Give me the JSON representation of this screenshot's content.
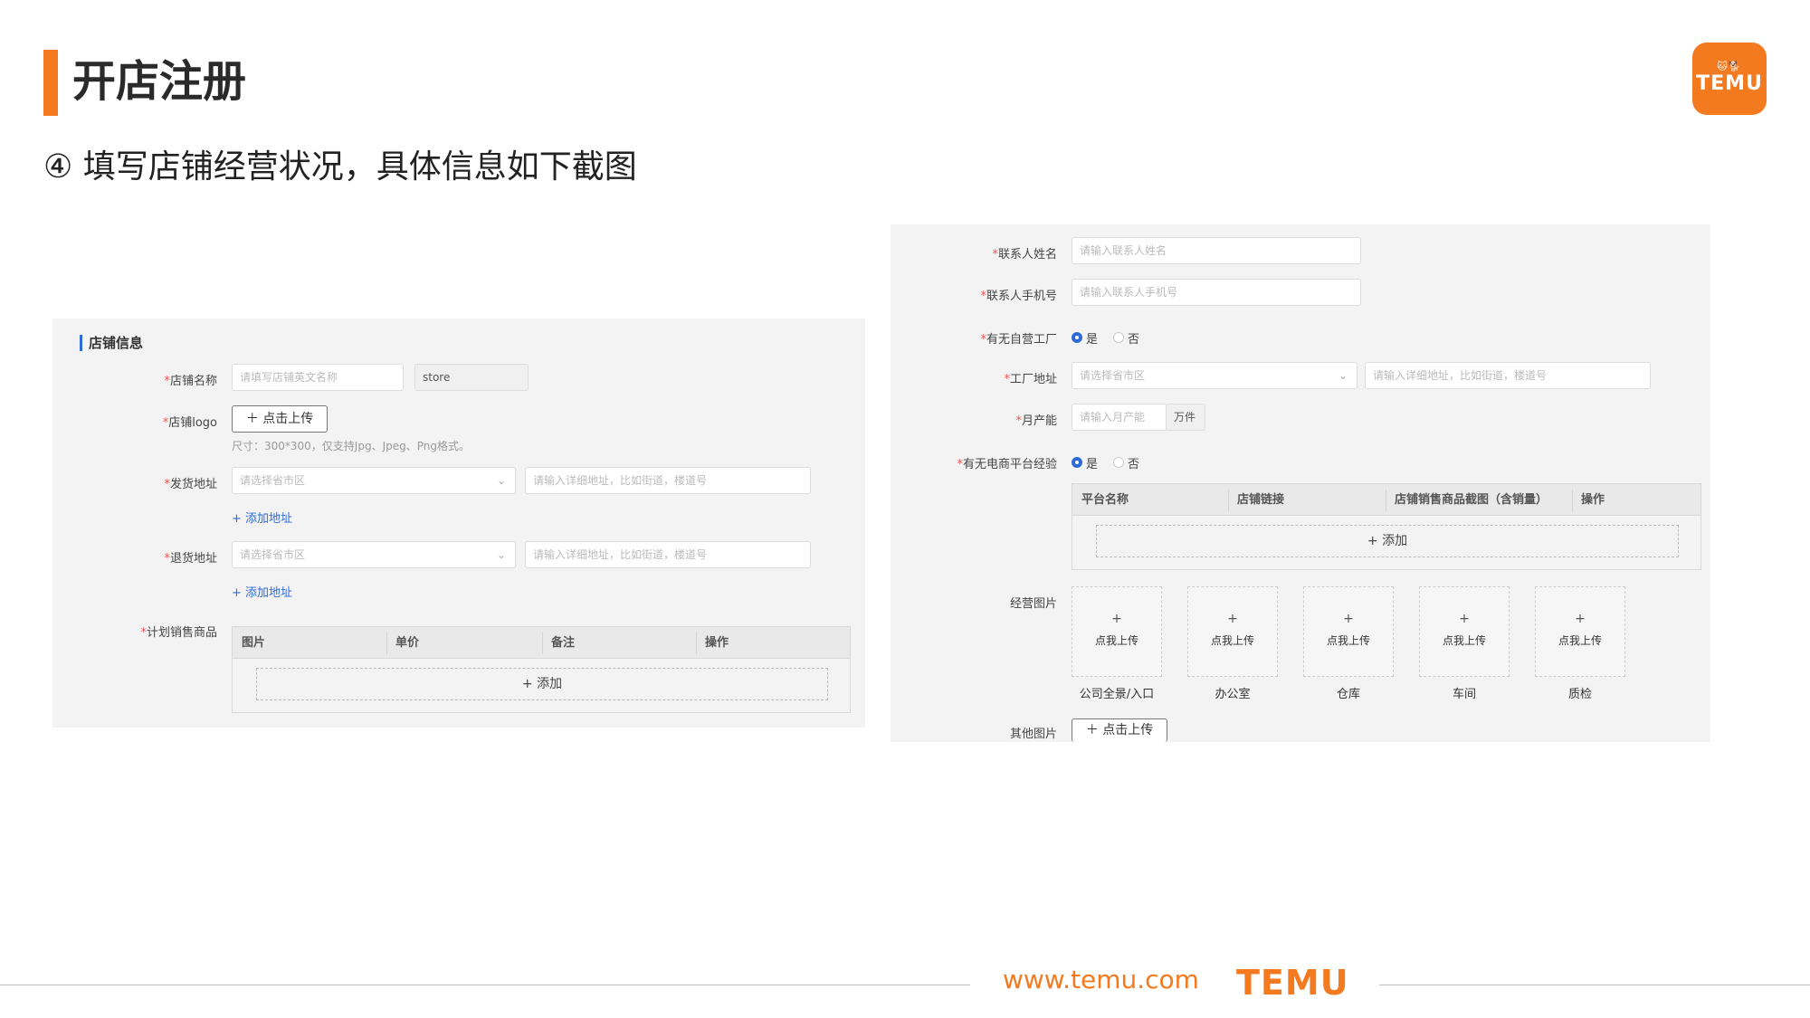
{
  "slide": {
    "title": "开店注册",
    "subtitle": "④ 填写店铺经营状况，具体信息如下截图",
    "logo": {
      "small": "🐱🐕",
      "word": "TEMU"
    },
    "footer": {
      "url": "www.temu.com",
      "brand": "TEMU"
    },
    "accent_color": "#f47a20"
  },
  "left_panel": {
    "section_title": "店铺信息",
    "store_name": {
      "label": "店铺名称",
      "placeholder": "请填写店铺英文名称",
      "suffix_value": "store"
    },
    "store_logo": {
      "label": "店铺logo",
      "button": "＋ 点击上传",
      "hint": "尺寸：300*300，仅支持Jpg、Jpeg、Png格式。"
    },
    "ship_address": {
      "label": "发货地址",
      "select_placeholder": "请选择省市区",
      "detail_placeholder": "请输入详细地址，比如街道，楼道号",
      "add_link": "+ 添加地址"
    },
    "return_address": {
      "label": "退货地址",
      "select_placeholder": "请选择省市区",
      "detail_placeholder": "请输入详细地址，比如街道，楼道号",
      "add_link": "+ 添加地址"
    },
    "planned_goods": {
      "label": "计划销售商品",
      "columns": [
        "图片",
        "单价",
        "备注",
        "操作"
      ],
      "add": "+ 添加"
    }
  },
  "right_panel": {
    "contact_name": {
      "label": "联系人姓名",
      "placeholder": "请输入联系人姓名"
    },
    "contact_phone": {
      "label": "联系人手机号",
      "placeholder": "请输入联系人手机号"
    },
    "own_factory": {
      "label": "有无自营工厂",
      "options": [
        "是",
        "否"
      ]
    },
    "factory_address": {
      "label": "工厂地址",
      "select_placeholder": "请选择省市区",
      "detail_placeholder": "请输入详细地址，比如街道，楼道号"
    },
    "monthly_capacity": {
      "label": "月产能",
      "placeholder": "请输入月产能",
      "unit": "万件"
    },
    "ecommerce_experience": {
      "label": "有无电商平台经验",
      "options": [
        "是",
        "否"
      ],
      "columns": [
        "平台名称",
        "店铺链接",
        "店铺销售商品截图（含销量）",
        "操作"
      ],
      "add": "+ 添加"
    },
    "business_photos": {
      "label": "经营图片",
      "upload_plus": "+",
      "upload_text": "点我上传",
      "captions": [
        "公司全景/入口",
        "办公室",
        "仓库",
        "车间",
        "质检"
      ]
    },
    "other_photos": {
      "label": "其他图片",
      "button": "＋ 点击上传"
    }
  }
}
